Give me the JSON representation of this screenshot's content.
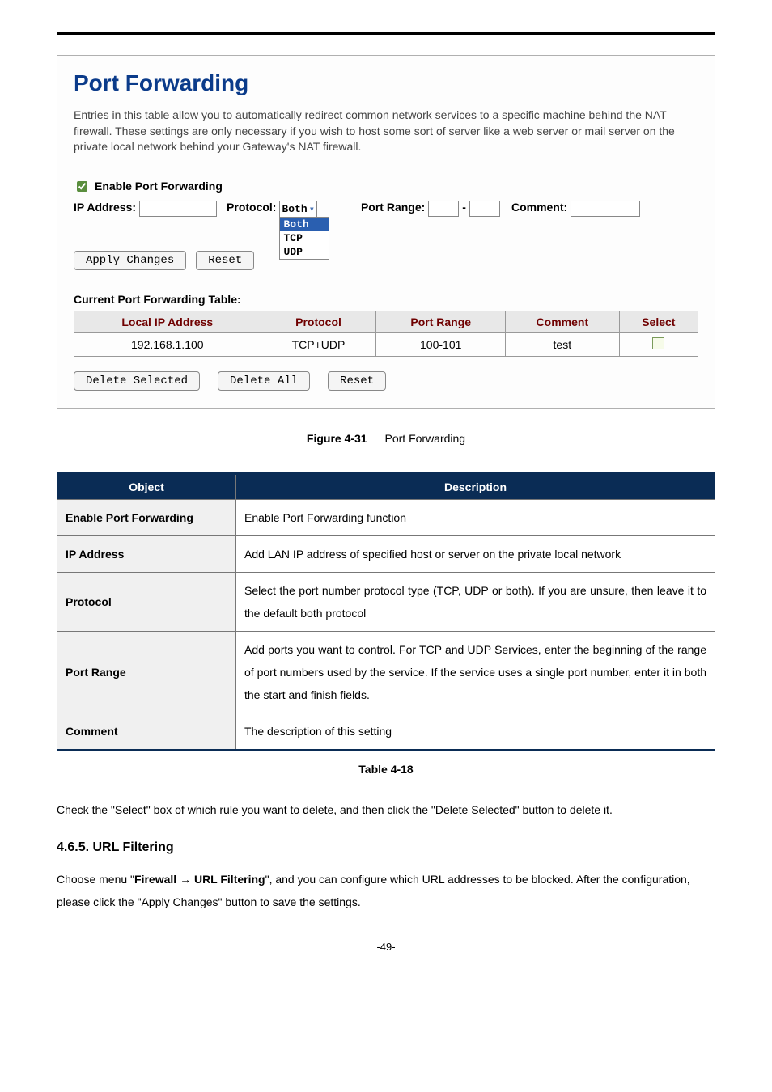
{
  "router": {
    "title": "Port Forwarding",
    "intro": "Entries in this table allow you to automatically redirect common network services to a specific machine behind the NAT firewall. These settings are only necessary if you wish to host some sort of server like a web server or mail server on the private local network behind your Gateway's NAT firewall.",
    "enable_label": "Enable Port Forwarding",
    "ip_label": "IP Address:",
    "protocol_label": "Protocol:",
    "protocol_selected": "Both",
    "protocol_options": {
      "both": "Both",
      "tcp": "TCP",
      "udp": "UDP"
    },
    "port_range_label": "Port Range:",
    "dash": "-",
    "comment_label": "Comment:",
    "apply_btn": "Apply Changes",
    "reset_btn": "Reset",
    "table_heading": "Current Port Forwarding Table:",
    "cols": {
      "ip": "Local IP Address",
      "proto": "Protocol",
      "range": "Port Range",
      "comment": "Comment",
      "select": "Select"
    },
    "row": {
      "ip": "192.168.1.100",
      "proto": "TCP+UDP",
      "range": "100-101",
      "comment": "test"
    },
    "delete_selected": "Delete Selected",
    "delete_all": "Delete All",
    "reset2": "Reset"
  },
  "figure": {
    "label": "Figure 4-31",
    "text": "Port Forwarding"
  },
  "desc": {
    "head_object": "Object",
    "head_desc": "Description",
    "rows": {
      "enable": {
        "obj": "Enable Port Forwarding",
        "desc": "Enable Port Forwarding function"
      },
      "ip": {
        "obj": "IP Address",
        "desc": "Add LAN IP address of specified host or server on the private local network"
      },
      "proto": {
        "obj": "Protocol",
        "desc": "Select the port number protocol type (TCP, UDP or both). If you are unsure, then leave it to the default both protocol"
      },
      "range": {
        "obj": "Port Range",
        "desc": "Add ports you want to control. For TCP and UDP Services, enter the beginning of the range of port numbers used by the service. If the service uses a single port number, enter it in both the start and finish fields."
      },
      "comment": {
        "obj": "Comment",
        "desc": "The description of this setting"
      }
    }
  },
  "table_label": "Table 4-18",
  "para1": "Check the \"Select\" box of which rule you want to delete, and then click the \"Delete Selected\" button to delete it.",
  "section": "4.6.5.  URL Filtering",
  "para2_a": "Choose menu \"",
  "para2_b": "Firewall ",
  "para2_arrow": "→",
  "para2_c": " URL Filtering",
  "para2_d": "\", and you can configure which URL addresses to be blocked. After the configuration, please click the \"Apply Changes\" button to save the settings.",
  "page_num": "-49-"
}
